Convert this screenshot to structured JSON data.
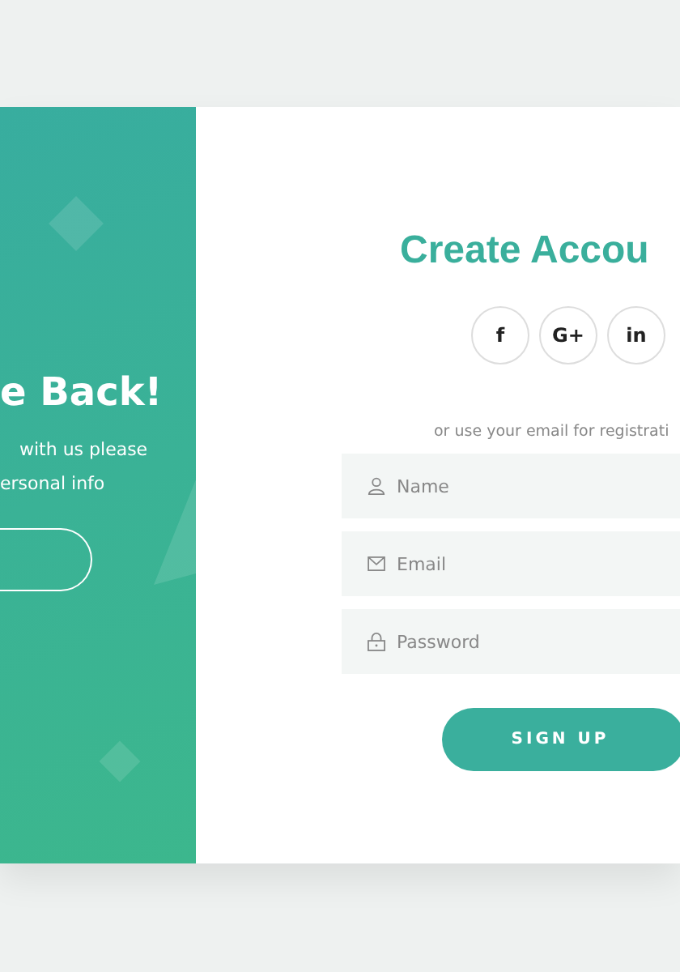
{
  "welcome_panel": {
    "title": "e Back!",
    "lines": [
      "with us please",
      "ersonal info"
    ]
  },
  "signup": {
    "title": "Create Accou",
    "social": [
      {
        "label": "f"
      },
      {
        "label": "G+"
      },
      {
        "label": "in"
      }
    ],
    "hint": "or use your email for registrati",
    "fields": [
      {
        "kind": "name",
        "placeholder": "Name"
      },
      {
        "kind": "email",
        "placeholder": "Email"
      },
      {
        "kind": "password",
        "placeholder": "Password"
      }
    ],
    "button": "SIGN UP"
  }
}
